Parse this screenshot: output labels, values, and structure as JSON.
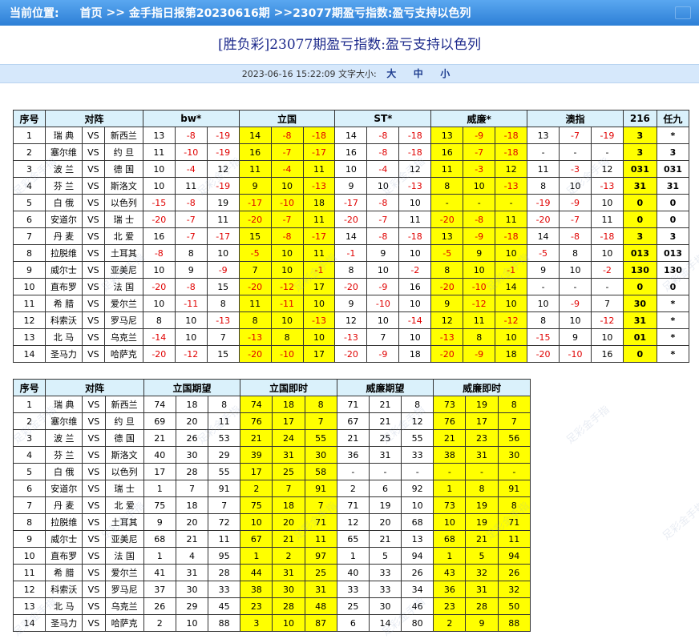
{
  "breadcrumb": {
    "location_label": "当前位置:",
    "home": "首页",
    "sep1": ">>",
    "report": "金手指日报第20230616期",
    "sep2": ">>",
    "current": "23077期盈亏指数:盈亏支持以色列"
  },
  "page_title": "[胜负彩]23077期盈亏指数:盈亏支持以色列",
  "meta": {
    "datetime": "2023-06-16 15:22:09",
    "font_size_label": "文字大小:",
    "size_large": "大",
    "size_medium": "中",
    "size_small": "小"
  },
  "watermark_text": "足彩金手指",
  "table1": {
    "headers": [
      "序号",
      "对阵",
      "bw*",
      "立国",
      "ST*",
      "威廉*",
      "澳指",
      "216",
      "任九"
    ],
    "rows": [
      {
        "idx": "1",
        "home": "瑞 典",
        "vs": "VS",
        "away": "新西兰",
        "bw": [
          "13",
          "-8",
          "-19"
        ],
        "lg": [
          "14",
          "-8",
          "-18"
        ],
        "st": [
          "14",
          "-8",
          "-18"
        ],
        "wl": [
          "13",
          "-9",
          "-18"
        ],
        "az": [
          "13",
          "-7",
          "-19"
        ],
        "c216": "3",
        "r9": "*"
      },
      {
        "idx": "2",
        "home": "塞尔维",
        "vs": "VS",
        "away": "约 旦",
        "bw": [
          "11",
          "-10",
          "-19"
        ],
        "lg": [
          "16",
          "-7",
          "-17"
        ],
        "st": [
          "16",
          "-8",
          "-18"
        ],
        "wl": [
          "16",
          "-7",
          "-18"
        ],
        "az": [
          "-",
          "-",
          "-"
        ],
        "c216": "3",
        "r9": "3"
      },
      {
        "idx": "3",
        "home": "波 兰",
        "vs": "VS",
        "away": "德 国",
        "bw": [
          "10",
          "-4",
          "12"
        ],
        "lg": [
          "11",
          "-4",
          "11"
        ],
        "st": [
          "10",
          "-4",
          "12"
        ],
        "wl": [
          "11",
          "-3",
          "12"
        ],
        "az": [
          "11",
          "-3",
          "12"
        ],
        "c216": "031",
        "r9": "031"
      },
      {
        "idx": "4",
        "home": "芬 兰",
        "vs": "VS",
        "away": "斯洛文",
        "bw": [
          "10",
          "11",
          "-19"
        ],
        "lg": [
          "9",
          "10",
          "-13"
        ],
        "st": [
          "9",
          "10",
          "-13"
        ],
        "wl": [
          "8",
          "10",
          "-13"
        ],
        "az": [
          "8",
          "10",
          "-13"
        ],
        "c216": "31",
        "r9": "31"
      },
      {
        "idx": "5",
        "home": "白 俄",
        "vs": "VS",
        "away": "以色列",
        "bw": [
          "-15",
          "-8",
          "19"
        ],
        "lg": [
          "-17",
          "-10",
          "18"
        ],
        "st": [
          "-17",
          "-8",
          "10"
        ],
        "wl": [
          "-",
          "-",
          "-"
        ],
        "az": [
          "-19",
          "-9",
          "10"
        ],
        "c216": "0",
        "r9": "0"
      },
      {
        "idx": "6",
        "home": "安道尔",
        "vs": "VS",
        "away": "瑞 士",
        "bw": [
          "-20",
          "-7",
          "11"
        ],
        "lg": [
          "-20",
          "-7",
          "11"
        ],
        "st": [
          "-20",
          "-7",
          "11"
        ],
        "wl": [
          "-20",
          "-8",
          "11"
        ],
        "az": [
          "-20",
          "-7",
          "11"
        ],
        "c216": "0",
        "r9": "0"
      },
      {
        "idx": "7",
        "home": "丹 麦",
        "vs": "VS",
        "away": "北 爱",
        "bw": [
          "16",
          "-7",
          "-17"
        ],
        "lg": [
          "15",
          "-8",
          "-17"
        ],
        "st": [
          "14",
          "-8",
          "-18"
        ],
        "wl": [
          "13",
          "-9",
          "-18"
        ],
        "az": [
          "14",
          "-8",
          "-18"
        ],
        "c216": "3",
        "r9": "3"
      },
      {
        "idx": "8",
        "home": "拉脱维",
        "vs": "VS",
        "away": "土耳其",
        "bw": [
          "-8",
          "8",
          "10"
        ],
        "lg": [
          "-5",
          "10",
          "11"
        ],
        "st": [
          "-1",
          "9",
          "10"
        ],
        "wl": [
          "-5",
          "9",
          "10"
        ],
        "az": [
          "-5",
          "8",
          "10"
        ],
        "c216": "013",
        "r9": "013"
      },
      {
        "idx": "9",
        "home": "威尔士",
        "vs": "VS",
        "away": "亚美尼",
        "bw": [
          "10",
          "9",
          "-9"
        ],
        "lg": [
          "7",
          "10",
          "-1"
        ],
        "st": [
          "8",
          "10",
          "-2"
        ],
        "wl": [
          "8",
          "10",
          "-1"
        ],
        "az": [
          "9",
          "10",
          "-2"
        ],
        "c216": "130",
        "r9": "130"
      },
      {
        "idx": "10",
        "home": "直布罗",
        "vs": "VS",
        "away": "法 国",
        "bw": [
          "-20",
          "-8",
          "15"
        ],
        "lg": [
          "-20",
          "-12",
          "17"
        ],
        "st": [
          "-20",
          "-9",
          "16"
        ],
        "wl": [
          "-20",
          "-10",
          "14"
        ],
        "az": [
          "-",
          "-",
          "-"
        ],
        "c216": "0",
        "r9": "0"
      },
      {
        "idx": "11",
        "home": "希 腊",
        "vs": "VS",
        "away": "爱尔兰",
        "bw": [
          "10",
          "-11",
          "8"
        ],
        "lg": [
          "11",
          "-11",
          "10"
        ],
        "st": [
          "9",
          "-10",
          "10"
        ],
        "wl": [
          "9",
          "-12",
          "10"
        ],
        "az": [
          "10",
          "-9",
          "7"
        ],
        "c216": "30",
        "r9": "*"
      },
      {
        "idx": "12",
        "home": "科索沃",
        "vs": "VS",
        "away": "罗马尼",
        "bw": [
          "8",
          "10",
          "-13"
        ],
        "lg": [
          "8",
          "10",
          "-13"
        ],
        "st": [
          "12",
          "10",
          "-14"
        ],
        "wl": [
          "12",
          "11",
          "-12"
        ],
        "az": [
          "8",
          "10",
          "-12"
        ],
        "c216": "31",
        "r9": "*"
      },
      {
        "idx": "13",
        "home": "北 马",
        "vs": "VS",
        "away": "乌克兰",
        "bw": [
          "-14",
          "10",
          "7"
        ],
        "lg": [
          "-13",
          "8",
          "10"
        ],
        "st": [
          "-13",
          "7",
          "10"
        ],
        "wl": [
          "-13",
          "8",
          "10"
        ],
        "az": [
          "-15",
          "9",
          "10"
        ],
        "c216": "01",
        "r9": "*"
      },
      {
        "idx": "14",
        "home": "圣马力",
        "vs": "VS",
        "away": "哈萨克",
        "bw": [
          "-20",
          "-12",
          "15"
        ],
        "lg": [
          "-20",
          "-10",
          "17"
        ],
        "st": [
          "-20",
          "-9",
          "18"
        ],
        "wl": [
          "-20",
          "-9",
          "18"
        ],
        "az": [
          "-20",
          "-10",
          "16"
        ],
        "c216": "0",
        "r9": "*"
      }
    ]
  },
  "table2": {
    "headers": [
      "序号",
      "对阵",
      "立国期望",
      "立国即时",
      "威廉期望",
      "威廉即时"
    ],
    "rows": [
      {
        "idx": "1",
        "home": "瑞 典",
        "vs": "VS",
        "away": "新西兰",
        "lgq": [
          "74",
          "18",
          "8"
        ],
        "lgj": [
          "74",
          "18",
          "8"
        ],
        "wlq": [
          "71",
          "21",
          "8"
        ],
        "wlj": [
          "73",
          "19",
          "8"
        ]
      },
      {
        "idx": "2",
        "home": "塞尔维",
        "vs": "VS",
        "away": "约 旦",
        "lgq": [
          "69",
          "20",
          "11"
        ],
        "lgj": [
          "76",
          "17",
          "7"
        ],
        "wlq": [
          "67",
          "21",
          "12"
        ],
        "wlj": [
          "76",
          "17",
          "7"
        ]
      },
      {
        "idx": "3",
        "home": "波 兰",
        "vs": "VS",
        "away": "德 国",
        "lgq": [
          "21",
          "26",
          "53"
        ],
        "lgj": [
          "21",
          "24",
          "55"
        ],
        "wlq": [
          "21",
          "25",
          "55"
        ],
        "wlj": [
          "21",
          "23",
          "56"
        ]
      },
      {
        "idx": "4",
        "home": "芬 兰",
        "vs": "VS",
        "away": "斯洛文",
        "lgq": [
          "40",
          "30",
          "29"
        ],
        "lgj": [
          "39",
          "31",
          "30"
        ],
        "wlq": [
          "36",
          "31",
          "33"
        ],
        "wlj": [
          "38",
          "31",
          "30"
        ]
      },
      {
        "idx": "5",
        "home": "白 俄",
        "vs": "VS",
        "away": "以色列",
        "lgq": [
          "17",
          "28",
          "55"
        ],
        "lgj": [
          "17",
          "25",
          "58"
        ],
        "wlq": [
          "-",
          "-",
          "-"
        ],
        "wlj": [
          "-",
          "-",
          "-"
        ]
      },
      {
        "idx": "6",
        "home": "安道尔",
        "vs": "VS",
        "away": "瑞 士",
        "lgq": [
          "1",
          "7",
          "91"
        ],
        "lgj": [
          "2",
          "7",
          "91"
        ],
        "wlq": [
          "2",
          "6",
          "92"
        ],
        "wlj": [
          "1",
          "8",
          "91"
        ]
      },
      {
        "idx": "7",
        "home": "丹 麦",
        "vs": "VS",
        "away": "北 爱",
        "lgq": [
          "75",
          "18",
          "7"
        ],
        "lgj": [
          "75",
          "18",
          "7"
        ],
        "wlq": [
          "71",
          "19",
          "10"
        ],
        "wlj": [
          "73",
          "19",
          "8"
        ]
      },
      {
        "idx": "8",
        "home": "拉脱维",
        "vs": "VS",
        "away": "土耳其",
        "lgq": [
          "9",
          "20",
          "72"
        ],
        "lgj": [
          "10",
          "20",
          "71"
        ],
        "wlq": [
          "12",
          "20",
          "68"
        ],
        "wlj": [
          "10",
          "19",
          "71"
        ]
      },
      {
        "idx": "9",
        "home": "威尔士",
        "vs": "VS",
        "away": "亚美尼",
        "lgq": [
          "68",
          "21",
          "11"
        ],
        "lgj": [
          "67",
          "21",
          "11"
        ],
        "wlq": [
          "65",
          "21",
          "13"
        ],
        "wlj": [
          "68",
          "21",
          "11"
        ]
      },
      {
        "idx": "10",
        "home": "直布罗",
        "vs": "VS",
        "away": "法 国",
        "lgq": [
          "1",
          "4",
          "95"
        ],
        "lgj": [
          "1",
          "2",
          "97"
        ],
        "wlq": [
          "1",
          "5",
          "94"
        ],
        "wlj": [
          "1",
          "5",
          "94"
        ]
      },
      {
        "idx": "11",
        "home": "希 腊",
        "vs": "VS",
        "away": "爱尔兰",
        "lgq": [
          "41",
          "31",
          "28"
        ],
        "lgj": [
          "44",
          "31",
          "25"
        ],
        "wlq": [
          "40",
          "33",
          "26"
        ],
        "wlj": [
          "43",
          "32",
          "26"
        ]
      },
      {
        "idx": "12",
        "home": "科索沃",
        "vs": "VS",
        "away": "罗马尼",
        "lgq": [
          "37",
          "30",
          "33"
        ],
        "lgj": [
          "38",
          "30",
          "31"
        ],
        "wlq": [
          "33",
          "33",
          "34"
        ],
        "wlj": [
          "36",
          "31",
          "32"
        ]
      },
      {
        "idx": "13",
        "home": "北 马",
        "vs": "VS",
        "away": "乌克兰",
        "lgq": [
          "26",
          "29",
          "45"
        ],
        "lgj": [
          "23",
          "28",
          "48"
        ],
        "wlq": [
          "25",
          "30",
          "46"
        ],
        "wlj": [
          "23",
          "28",
          "50"
        ]
      },
      {
        "idx": "14",
        "home": "圣马力",
        "vs": "VS",
        "away": "哈萨克",
        "lgq": [
          "2",
          "10",
          "88"
        ],
        "lgj": [
          "3",
          "10",
          "87"
        ],
        "wlq": [
          "6",
          "14",
          "80"
        ],
        "wlj": [
          "2",
          "9",
          "88"
        ]
      }
    ]
  }
}
